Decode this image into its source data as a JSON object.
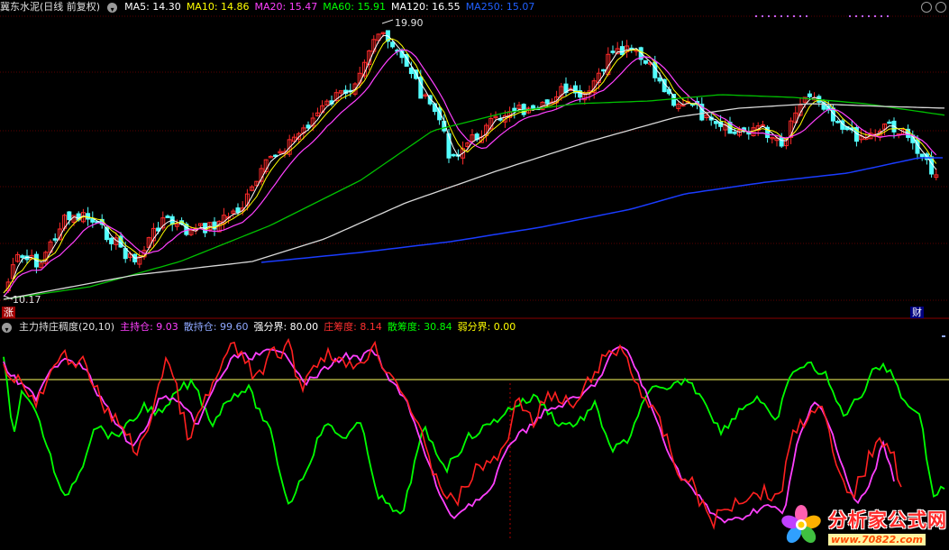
{
  "main_header": {
    "title": "冀东水泥(日线 前复权)",
    "ma_items": [
      {
        "label": "MA5: 14.30",
        "color": "#ffffff"
      },
      {
        "label": "MA10: 14.86",
        "color": "#ffff00"
      },
      {
        "label": "MA20: 15.47",
        "color": "#ff40ff"
      },
      {
        "label": "MA60: 15.91",
        "color": "#00ff00"
      },
      {
        "label": "MA120: 16.55",
        "color": "#ffffff"
      },
      {
        "label": "MA250: 15.07",
        "color": "#2060ff"
      }
    ]
  },
  "price_panel": {
    "high_label": "19.90",
    "low_label": "10.17",
    "gridline_color": "#5a0000",
    "up_color": "#ff2a2a",
    "down_color": "#54ffff",
    "ma_colors": {
      "ma5": "#ffffff",
      "ma10": "#ffff00",
      "ma20": "#ff40ff",
      "ma60": "#00c000",
      "ma120": "#d8d8d8",
      "ma250": "#1a3cff"
    }
  },
  "badges": {
    "left": "涨",
    "right": "财"
  },
  "indicator_header": {
    "title": "主力持庄稠度(20,10)",
    "items": [
      {
        "label": "主持仓: 9.03",
        "color": "#ff40ff"
      },
      {
        "label": "散持仓: 99.60",
        "color": "#8fa8ff"
      },
      {
        "label": "强分界: 80.00",
        "color": "#ffffff"
      },
      {
        "label": "庄筹度: 8.14",
        "color": "#ff3030"
      },
      {
        "label": "散筹度: 30.84",
        "color": "#00ff00"
      },
      {
        "label": "弱分界: 0.00",
        "color": "#ffff00"
      }
    ]
  },
  "indicator_panel": {
    "strong_line_color": "#ffff60",
    "series_colors": {
      "main": "#ff40ff",
      "retail": "#00ff00",
      "dealer": "#ff2020"
    }
  },
  "watermark": {
    "title": "分析家公式网",
    "url": "www.70822.com"
  },
  "icons": [
    "chevron-down-icon",
    "restore-icon",
    "maximize-icon",
    "flower-logo-icon"
  ]
}
